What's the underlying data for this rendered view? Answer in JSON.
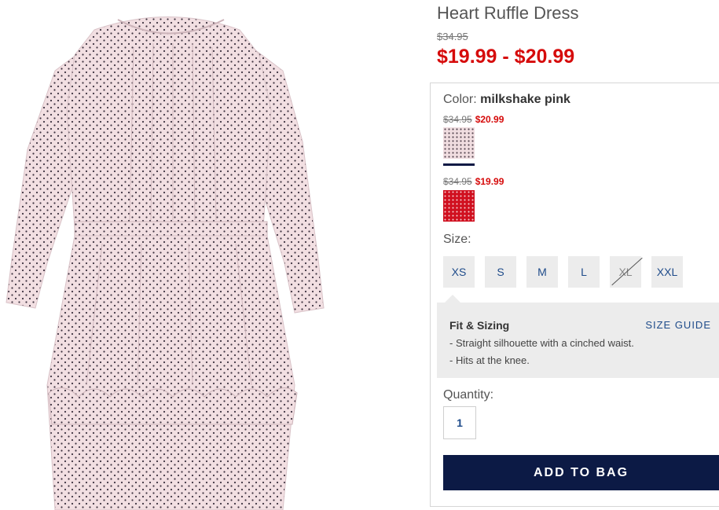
{
  "product": {
    "title": "Heart Ruffle Dress",
    "original_price": "$34.95",
    "sale_price_range": "$19.99 - $20.99",
    "image_alt": "pink dress with small black print, long sleeves, ruffled tiered skirt"
  },
  "color": {
    "label": "Color:",
    "selected_name": "milkshake pink",
    "swatches": [
      {
        "name": "milkshake pink",
        "was": "$34.95",
        "now": "$20.99",
        "selected": true,
        "swatch_color": "#f0dde0"
      },
      {
        "name": "red",
        "was": "$34.95",
        "now": "$19.99",
        "selected": false,
        "swatch_color": "#d01020"
      }
    ]
  },
  "size": {
    "label": "Size:",
    "options": [
      {
        "label": "XS",
        "available": true
      },
      {
        "label": "S",
        "available": true
      },
      {
        "label": "M",
        "available": true
      },
      {
        "label": "L",
        "available": true
      },
      {
        "label": "XL",
        "available": false
      },
      {
        "label": "XXL",
        "available": true
      }
    ]
  },
  "fit": {
    "title": "Fit & Sizing",
    "size_guide_label": "SIZE GUIDE",
    "lines": [
      "- Straight silhouette with a cinched waist.",
      "- Hits at the knee."
    ]
  },
  "quantity": {
    "label": "Quantity:",
    "value": "1"
  },
  "cta": {
    "add_to_bag_label": "ADD TO BAG"
  },
  "colors": {
    "sale_red": "#d60b0b",
    "navy": "#0c1a45",
    "link_blue": "#1e4b8a"
  }
}
